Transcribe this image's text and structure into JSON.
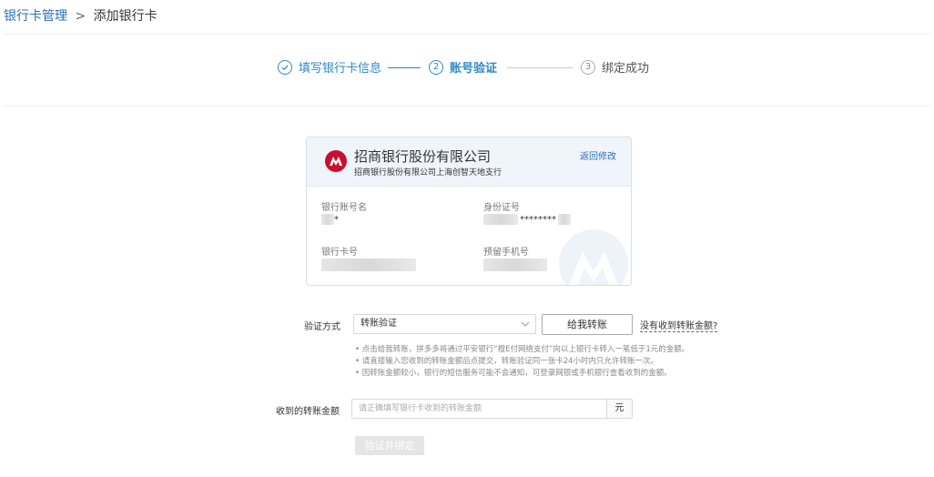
{
  "breadcrumb": {
    "parent": "银行卡管理",
    "separator": ">",
    "current": "添加银行卡"
  },
  "steps": [
    {
      "index": "1",
      "label": "填写银行卡信息",
      "status": "done"
    },
    {
      "index": "2",
      "label": "账号验证",
      "status": "active"
    },
    {
      "index": "3",
      "label": "绑定成功",
      "status": "todo"
    }
  ],
  "card": {
    "bank_name": "招商银行股份有限公司",
    "branch_name": "招商银行股份有限公司上海创智天地支行",
    "back_link": "返回修改",
    "account_name_label": "银行账号名",
    "account_name_value": "*",
    "id_label": "身份证号",
    "id_value": "********",
    "card_no_label": "银行卡号",
    "phone_label": "预留手机号"
  },
  "form": {
    "method_label": "验证方式",
    "method_selected": "转账验证",
    "transfer_button": "给我转账",
    "no_receive_link": "没有收到转账金额?",
    "tips": [
      "• 点击给我转账，拼多多将通过平安银行“橙E付网络支付”向以上银行卡转入一笔低于1元的金额。",
      "• 请直接输入您收到的转账金额后点提交，转账验证同一张卡24小时内只允许转账一次。",
      "• 因转账金额较小，银行的短信服务可能不会通知，可登录网银或手机银行查看收到的金额。"
    ],
    "amount_label": "收到的转账金额",
    "amount_placeholder": "请正确填写银行卡收到的转账金额",
    "amount_value": "",
    "amount_unit": "元",
    "submit_button": "验证并绑定"
  },
  "colors": {
    "accent": "#2d88c8",
    "link": "#2d6fb7",
    "bank_red": "#c8102e",
    "disabled": "#e5e5e5"
  }
}
